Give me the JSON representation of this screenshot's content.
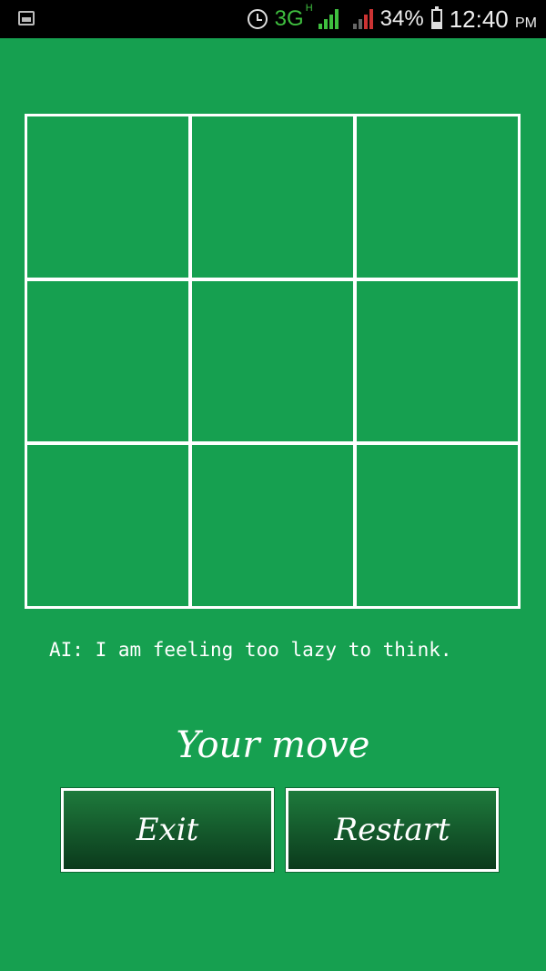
{
  "status_bar": {
    "network_type": "3G",
    "network_sub": "H",
    "battery_percent": "34%",
    "battery_level": 0.34,
    "time": "12:40",
    "ampm": "PM",
    "icons": [
      "image-icon",
      "alarm-icon",
      "signal-icon",
      "signal-icon",
      "battery-icon"
    ]
  },
  "board": {
    "rows": 3,
    "cols": 3,
    "cells": [
      "",
      "",
      "",
      "",
      "",
      "",
      "",
      "",
      ""
    ]
  },
  "ai_message": "AI: I am feeling too lazy to think.",
  "turn_text": "Your move",
  "buttons": {
    "exit": "Exit",
    "restart": "Restart"
  },
  "colors": {
    "background": "#16a050",
    "grid_lines": "#ffffff",
    "button_top": "#1e7a3c",
    "button_bottom": "#0b3a1c"
  }
}
